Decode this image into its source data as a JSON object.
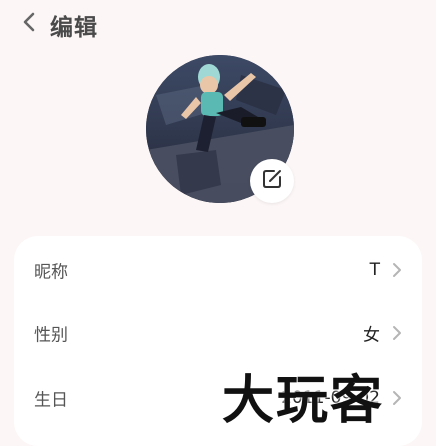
{
  "header": {
    "title": "编辑",
    "back_icon": "chevron-left-icon"
  },
  "profile": {
    "avatar_alt": "avatar",
    "edit_icon": "edit-icon"
  },
  "form": {
    "rows": [
      {
        "label": "昵称",
        "value": "T"
      },
      {
        "label": "性别",
        "value": "女"
      },
      {
        "label": "生日",
        "value": "2011-09-02"
      }
    ]
  },
  "watermark": {
    "text": "大玩客"
  },
  "colors": {
    "page_bg": "#fcf6f6",
    "card_bg": "#ffffff",
    "title_text": "#4a4a4a",
    "chevron": "#b5b5b5"
  }
}
